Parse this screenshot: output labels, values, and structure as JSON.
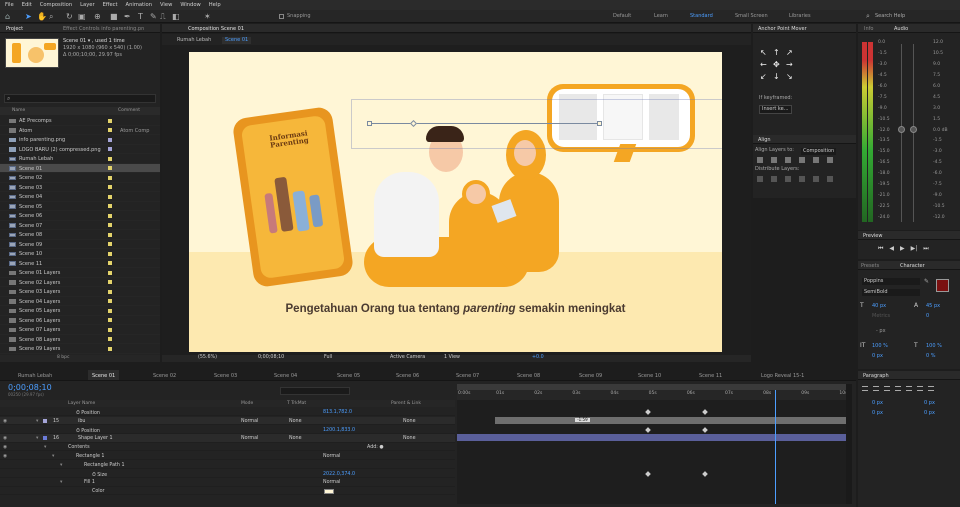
{
  "menu": [
    "File",
    "Edit",
    "Composition",
    "Layer",
    "Effect",
    "Animation",
    "View",
    "Window",
    "Help"
  ],
  "toolbar": {
    "snapping": "Snapping"
  },
  "workspaces": [
    "Default",
    "Learn",
    "Standard",
    "Small Screen",
    "Libraries"
  ],
  "active_workspace": "Standard",
  "search_help": "Search Help",
  "project": {
    "tab": "Project",
    "effect_controls_tab": "Effect Controls  info parenting.pn",
    "selected_name": "Scene 01 ▾ , used 1 time",
    "selected_size": "1920 x 1080 (960 x 540) (1.00)",
    "selected_duration": "Δ 0;00;10;00, 29.97 fps",
    "col_name": "Name",
    "col_type": "Comment",
    "items": [
      {
        "name": "AE Precomps",
        "type": "",
        "color": "#e3d36b",
        "kind": "folder"
      },
      {
        "name": "Atom",
        "type": "Atom Comp",
        "color": "#e3d36b",
        "kind": "folder"
      },
      {
        "name": "info parenting.png",
        "type": "",
        "color": "#a5a5d8",
        "kind": "file"
      },
      {
        "name": "LOGO BARU (2) compressed.png",
        "type": "",
        "color": "#a5a5d8",
        "kind": "file"
      },
      {
        "name": "Rumah Lebah",
        "type": "",
        "color": "#e3d36b",
        "kind": "comp"
      },
      {
        "name": "Scene 01",
        "type": "",
        "color": "#e3d36b",
        "kind": "comp"
      },
      {
        "name": "Scene 02",
        "type": "",
        "color": "#e3d36b",
        "kind": "comp"
      },
      {
        "name": "Scene 03",
        "type": "",
        "color": "#e3d36b",
        "kind": "comp"
      },
      {
        "name": "Scene 04",
        "type": "",
        "color": "#e3d36b",
        "kind": "comp"
      },
      {
        "name": "Scene 05",
        "type": "",
        "color": "#e3d36b",
        "kind": "comp"
      },
      {
        "name": "Scene 06",
        "type": "",
        "color": "#e3d36b",
        "kind": "comp"
      },
      {
        "name": "Scene 07",
        "type": "",
        "color": "#e3d36b",
        "kind": "comp"
      },
      {
        "name": "Scene 08",
        "type": "",
        "color": "#e3d36b",
        "kind": "comp"
      },
      {
        "name": "Scene 09",
        "type": "",
        "color": "#e3d36b",
        "kind": "comp"
      },
      {
        "name": "Scene 10",
        "type": "",
        "color": "#e3d36b",
        "kind": "comp"
      },
      {
        "name": "Scene 11",
        "type": "",
        "color": "#e3d36b",
        "kind": "comp"
      },
      {
        "name": "Scene 01 Layers",
        "type": "",
        "color": "#e3d36b",
        "kind": "folder"
      },
      {
        "name": "Scene 02 Layers",
        "type": "",
        "color": "#e3d36b",
        "kind": "folder"
      },
      {
        "name": "Scene 03 Layers",
        "type": "",
        "color": "#e3d36b",
        "kind": "folder"
      },
      {
        "name": "Scene 04 Layers",
        "type": "",
        "color": "#e3d36b",
        "kind": "folder"
      },
      {
        "name": "Scene 05 Layers",
        "type": "",
        "color": "#e3d36b",
        "kind": "folder"
      },
      {
        "name": "Scene 06 Layers",
        "type": "",
        "color": "#e3d36b",
        "kind": "folder"
      },
      {
        "name": "Scene 07 Layers",
        "type": "",
        "color": "#e3d36b",
        "kind": "folder"
      },
      {
        "name": "Scene 08 Layers",
        "type": "",
        "color": "#e3d36b",
        "kind": "folder"
      },
      {
        "name": "Scene 09 Layers",
        "type": "",
        "color": "#e3d36b",
        "kind": "folder"
      }
    ],
    "bpc": "8 bpc"
  },
  "composition": {
    "tab": "Composition  Scene 01",
    "breadcrumb": [
      "Rumah Lebah",
      "Scene 01"
    ],
    "zoom": "(55.6%)",
    "timecode": "0;00;08;10",
    "resolution": "Full",
    "camera": "Active Camera",
    "view": "1 View",
    "exposure": "+0.0",
    "phone_title": "Informasi Parenting",
    "caption_a": "Pengetahuan Orang tua tentang ",
    "caption_b": "parenting",
    "caption_c": " semakin meningkat"
  },
  "anchor_mover": {
    "title": "Anchor Point Mover",
    "if_keyframed": "If keyframed:",
    "insert": "Insert ke..."
  },
  "align": {
    "title": "Align",
    "align_to_label": "Align Layers to:",
    "align_to_value": "Composition",
    "distribute": "Distribute Layers:"
  },
  "info_tab": "Info",
  "audio_tab": "Audio",
  "audio_left": [
    "0.0",
    "-1.5",
    "-3.0",
    "-4.5",
    "-6.0",
    "-7.5",
    "-9.0",
    "-10.5",
    "-12.0",
    "-13.5",
    "-15.0",
    "-16.5",
    "-18.0",
    "-19.5",
    "-21.0",
    "-22.5",
    "-24.0"
  ],
  "audio_right": [
    "12.0 dB",
    "6.0",
    "0.0",
    "-6.0",
    "-12.0",
    "-18.0",
    "-24.0",
    "-30.0",
    "-36.0",
    "-42.0",
    "-48.0"
  ],
  "audio_right2": [
    "12.0",
    "10.5",
    "9.0",
    "7.5",
    "6.0",
    "4.5",
    "3.0",
    "1.5",
    "0.0 dB",
    "-1.5",
    "-3.0",
    "-4.5",
    "-6.0",
    "-7.5",
    "-9.0",
    "-10.5",
    "-12.0"
  ],
  "preview_tab": "Preview",
  "presets_tab": "Presets",
  "character_tab": "Character",
  "character": {
    "font": "Poppins",
    "style": "SemiBold",
    "size": "40 px",
    "leading": "45 px",
    "tracking": "0",
    "kern": "Metrics",
    "stroke": "- px",
    "scale_v": "100 %",
    "scale_h": "100 %",
    "baseline": "0 px",
    "tsume": "0 %"
  },
  "paragraph_tab": "Paragraph",
  "paragraph": {
    "indent_l": "0 px",
    "indent_r": "0 px",
    "space_b": "0 px",
    "space_a": "0 px"
  },
  "timeline": {
    "tabs": [
      "Rumah Lebah",
      "Scene 01",
      "Scene 02",
      "Scene 03",
      "Scene 04",
      "Scene 05",
      "Scene 06",
      "Scene 07",
      "Scene 08",
      "Scene 09",
      "Scene 10",
      "Scene 11",
      "Logo Reveal 15-1"
    ],
    "active_tab": "Scene 01",
    "current_time": "0;00;08;10",
    "frame_info": "00250 (29.97 fps)",
    "col_layer": "Layer Name",
    "col_mode": "Mode",
    "col_trkmat": "T TrkMat",
    "col_parent": "Parent & Link",
    "ruler": [
      "0:00s",
      "01s",
      "02s",
      "03s",
      "04s",
      "05s",
      "06s",
      "07s",
      "08s",
      "09s",
      "10s"
    ],
    "playhead_sec": 8.33,
    "layers": [
      {
        "indent": 2,
        "num": "",
        "name": "Position",
        "mode": "",
        "trk": "",
        "value": "813.1,782.0",
        "parent": "",
        "type": "prop"
      },
      {
        "indent": 0,
        "num": "15",
        "name": "ibu",
        "mode": "Normal",
        "trk": "None",
        "value": "",
        "parent": "None",
        "type": "layer",
        "color": "#a5a5d8"
      },
      {
        "indent": 2,
        "num": "",
        "name": "Position",
        "mode": "",
        "trk": "",
        "value": "1200.1,833.0",
        "parent": "",
        "type": "prop"
      },
      {
        "indent": 0,
        "num": "16",
        "name": "Shape Layer 1",
        "mode": "Normal",
        "trk": "None",
        "value": "",
        "parent": "None",
        "type": "layer",
        "color": "#6b7bd8"
      },
      {
        "indent": 1,
        "num": "",
        "name": "Contents",
        "mode": "",
        "trk": "",
        "value": "",
        "parent": "",
        "type": "group",
        "add": "Add: ●"
      },
      {
        "indent": 2,
        "num": "",
        "name": "Rectangle 1",
        "mode": "Normal",
        "trk": "",
        "value": "",
        "parent": "",
        "type": "group"
      },
      {
        "indent": 3,
        "num": "",
        "name": "Rectangle Path 1",
        "mode": "",
        "trk": "",
        "value": "",
        "parent": "",
        "type": "group"
      },
      {
        "indent": 4,
        "num": "",
        "name": "Size",
        "mode": "",
        "trk": "",
        "value": "2022.0,374.0",
        "parent": "",
        "type": "prop"
      },
      {
        "indent": 3,
        "num": "",
        "name": "Fill 1",
        "mode": "Normal",
        "trk": "",
        "value": "",
        "parent": "",
        "type": "group"
      },
      {
        "indent": 4,
        "num": "",
        "name": "Color",
        "mode": "",
        "trk": "",
        "value": "",
        "parent": "",
        "type": "color"
      }
    ],
    "bar_tooltip": "-1:59"
  },
  "colors": {
    "accent": "#4c9eff",
    "canvas_bg": "#fff6d6",
    "orange": "#f4a623",
    "wall": "#fdf3c7"
  }
}
